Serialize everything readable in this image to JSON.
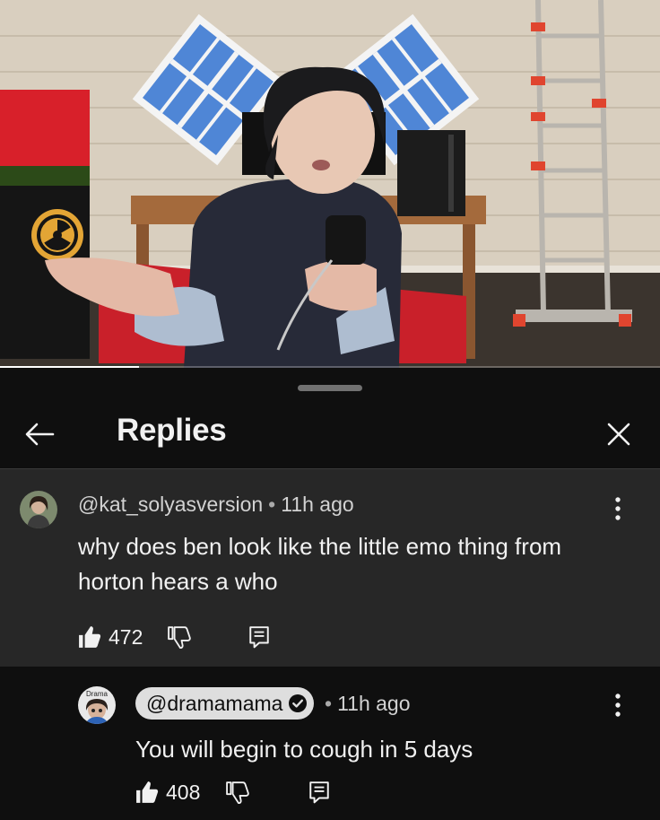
{
  "video": {
    "progress_percent": 21,
    "radiation_symbol": "radiation-icon"
  },
  "panel": {
    "title": "Replies",
    "back_icon": "arrow-left-icon",
    "close_icon": "close-icon"
  },
  "parent_comment": {
    "author": "@kat_solyasversion",
    "separator": "•",
    "time": "11h ago",
    "text_line1": "why does ben look like the little emo thing from",
    "text_line2": "horton hears a who",
    "like_count": "472",
    "icons": [
      "thumbs-up-icon",
      "thumbs-down-icon",
      "reply-icon",
      "more-vert-icon"
    ]
  },
  "reply": {
    "author": "@dramamama",
    "verified": true,
    "separator": "•",
    "time": "11h ago",
    "avatar_label": "Drama",
    "text": "You will begin to cough in 5 days",
    "like_count": "408",
    "icons": [
      "thumbs-up-icon",
      "thumbs-down-icon",
      "reply-icon",
      "more-vert-icon"
    ]
  },
  "colors": {
    "background": "#0f0f0f",
    "highlight": "#272727",
    "pill": "#dedede",
    "text": "#f1f1f1",
    "muted": "#aaaaaa"
  }
}
